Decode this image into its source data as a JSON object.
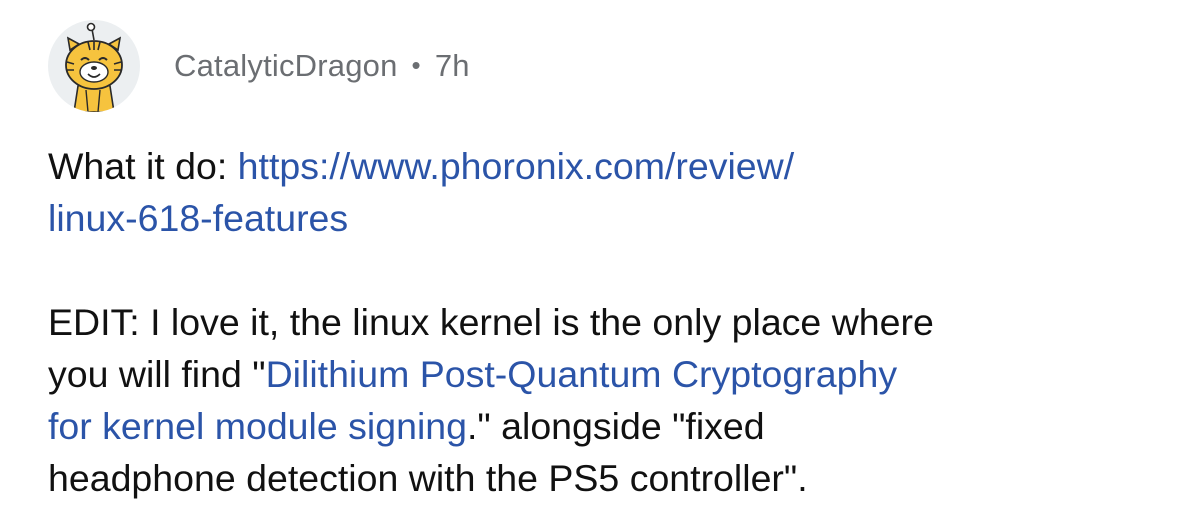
{
  "comment": {
    "author": "CatalyticDragon",
    "separator": "•",
    "age": "7h",
    "avatar_icon": "snoo-tiger-avatar-icon",
    "paragraph1": {
      "prefix": "What it do: ",
      "link_line1": "https://www.phoronix.com/review/",
      "link_line2": "linux-618-features"
    },
    "paragraph2": {
      "line1": "EDIT: I love it, the linux kernel is the only place where",
      "line2_prefix": "you will find \"",
      "link_part1": "Dilithium Post-Quantum Cryptography",
      "link_part2": "for kernel module signing",
      "line3_suffix": ".\" alongside \"fixed",
      "line4": "headphone detection with the PS5 controller\"."
    }
  },
  "colors": {
    "link": "#2b54a8",
    "meta": "#6b6e72",
    "text": "#111111",
    "avatar_bg": "#eceff1",
    "avatar_fur": "#f6c33e"
  }
}
